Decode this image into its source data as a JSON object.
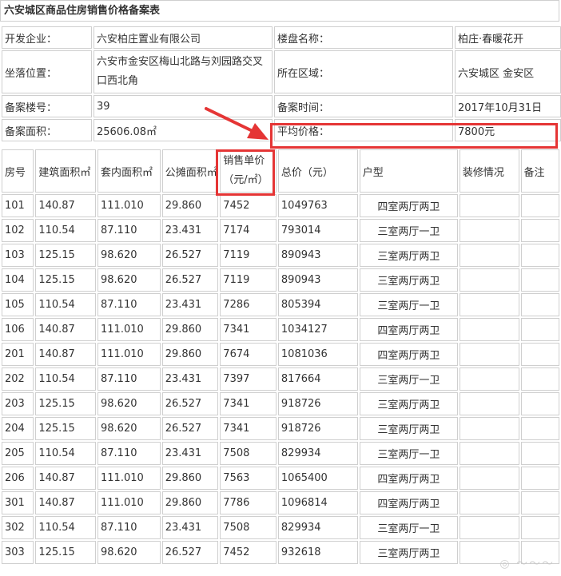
{
  "title": "六安城区商品住房销售价格备案表",
  "info": {
    "developer_label": "开发企业：",
    "developer_value": "六安柏庄置业有限公司",
    "project_label": "楼盘名称：",
    "project_value": "柏庄·春暖花开",
    "location_label": "坐落位置：",
    "location_value": "六安市金安区梅山北路与刘园路交叉口西北角",
    "district_label": "所在区域：",
    "district_value": "六安城区 金安区",
    "building_label": "备案楼号：",
    "building_value": "39",
    "record_time_label": "备案时间：",
    "record_time_value": "2017年10月31日",
    "area_label": "备案面积：",
    "area_value": "25606.08㎡",
    "avg_price_label": "平均价格：",
    "avg_price_value": "7800元"
  },
  "columns": {
    "room": "房号",
    "build_area": "建筑面积㎡",
    "inner_area": "套内面积㎡",
    "shared_area": "公摊面积㎡",
    "unit_price": "销售单价（元/㎡）",
    "total_price": "总价（元）",
    "layout": "户型",
    "decoration": "装修情况",
    "note": "备注"
  },
  "rows": [
    {
      "room": "101",
      "build": "140.87",
      "inner": "111.010",
      "shared": "29.860",
      "price": "7452",
      "total": "1049763",
      "layout": "四室两厅两卫",
      "deco": "",
      "note": ""
    },
    {
      "room": "102",
      "build": "110.54",
      "inner": "87.110",
      "shared": "23.431",
      "price": "7174",
      "total": "793014",
      "layout": "三室两厅一卫",
      "deco": "",
      "note": ""
    },
    {
      "room": "103",
      "build": "125.15",
      "inner": "98.620",
      "shared": "26.527",
      "price": "7119",
      "total": "890943",
      "layout": "三室两厅两卫",
      "deco": "",
      "note": ""
    },
    {
      "room": "104",
      "build": "125.15",
      "inner": "98.620",
      "shared": "26.527",
      "price": "7119",
      "total": "890943",
      "layout": "三室两厅两卫",
      "deco": "",
      "note": ""
    },
    {
      "room": "105",
      "build": "110.54",
      "inner": "87.110",
      "shared": "23.431",
      "price": "7286",
      "total": "805394",
      "layout": "三室两厅一卫",
      "deco": "",
      "note": ""
    },
    {
      "room": "106",
      "build": "140.87",
      "inner": "111.010",
      "shared": "29.860",
      "price": "7341",
      "total": "1034127",
      "layout": "四室两厅两卫",
      "deco": "",
      "note": ""
    },
    {
      "room": "201",
      "build": "140.87",
      "inner": "111.010",
      "shared": "29.860",
      "price": "7674",
      "total": "1081036",
      "layout": "四室两厅两卫",
      "deco": "",
      "note": ""
    },
    {
      "room": "202",
      "build": "110.54",
      "inner": "87.110",
      "shared": "23.431",
      "price": "7397",
      "total": "817664",
      "layout": "三室两厅一卫",
      "deco": "",
      "note": ""
    },
    {
      "room": "203",
      "build": "125.15",
      "inner": "98.620",
      "shared": "26.527",
      "price": "7341",
      "total": "918726",
      "layout": "三室两厅两卫",
      "deco": "",
      "note": ""
    },
    {
      "room": "204",
      "build": "125.15",
      "inner": "98.620",
      "shared": "26.527",
      "price": "7341",
      "total": "918726",
      "layout": "三室两厅两卫",
      "deco": "",
      "note": ""
    },
    {
      "room": "205",
      "build": "110.54",
      "inner": "87.110",
      "shared": "23.431",
      "price": "7508",
      "total": "829934",
      "layout": "三室两厅一卫",
      "deco": "",
      "note": ""
    },
    {
      "room": "206",
      "build": "140.87",
      "inner": "111.010",
      "shared": "29.860",
      "price": "7563",
      "total": "1065400",
      "layout": "四室两厅两卫",
      "deco": "",
      "note": ""
    },
    {
      "room": "301",
      "build": "140.87",
      "inner": "111.010",
      "shared": "29.860",
      "price": "7786",
      "total": "1096814",
      "layout": "四室两厅两卫",
      "deco": "",
      "note": ""
    },
    {
      "room": "302",
      "build": "110.54",
      "inner": "87.110",
      "shared": "23.431",
      "price": "7508",
      "total": "829934",
      "layout": "三室两厅一卫",
      "deco": "",
      "note": ""
    },
    {
      "room": "303",
      "build": "125.15",
      "inner": "98.620",
      "shared": "26.527",
      "price": "7452",
      "total": "932618",
      "layout": "三室两厅两卫",
      "deco": "",
      "note": ""
    }
  ],
  "highlight_color": "#e53535",
  "icons": {
    "annotation_arrow": "red-arrow-icon",
    "watermark": "watermark-logo"
  }
}
